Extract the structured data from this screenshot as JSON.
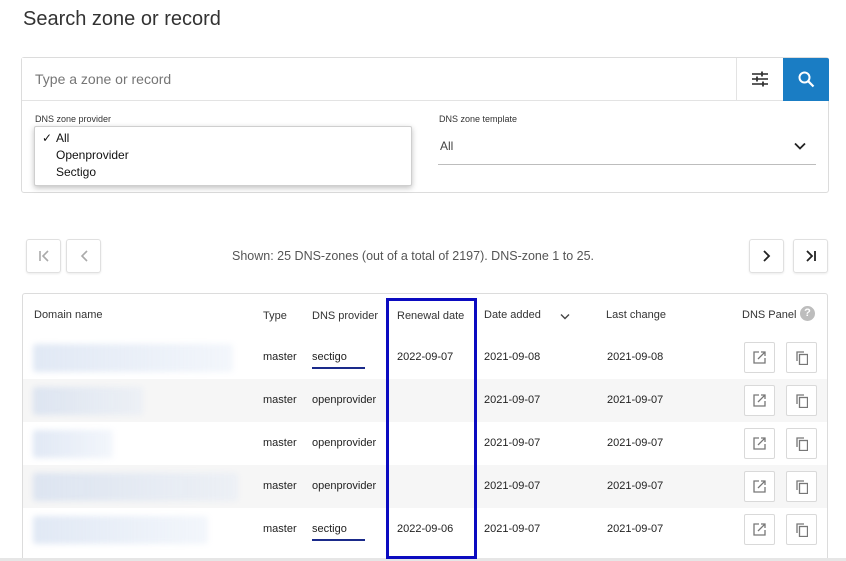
{
  "page_title": "Search zone or record",
  "search": {
    "placeholder": "Type a zone or record",
    "value": ""
  },
  "filters": {
    "provider_label": "DNS zone provider",
    "provider_options": [
      {
        "label": "All",
        "checked": true
      },
      {
        "label": "Openprovider",
        "checked": false
      },
      {
        "label": "Sectigo",
        "checked": false
      }
    ],
    "template_label": "DNS zone template",
    "template_value": "All"
  },
  "pagination": {
    "status": "Shown: 25 DNS-zones (out of a total of 2197). DNS-zone 1 to 25."
  },
  "table": {
    "headers": {
      "domain": "Domain name",
      "type": "Type",
      "provider": "DNS provider",
      "renewal": "Renewal date",
      "added": "Date added",
      "changed": "Last change",
      "panel": "DNS Panel"
    },
    "rows": [
      {
        "type": "master",
        "provider": "sectigo",
        "renewal": "2022-09-07",
        "added": "2021-09-08",
        "changed": "2021-09-08"
      },
      {
        "type": "master",
        "provider": "openprovider",
        "renewal": "",
        "added": "2021-09-07",
        "changed": "2021-09-07"
      },
      {
        "type": "master",
        "provider": "openprovider",
        "renewal": "",
        "added": "2021-09-07",
        "changed": "2021-09-07"
      },
      {
        "type": "master",
        "provider": "openprovider",
        "renewal": "",
        "added": "2021-09-07",
        "changed": "2021-09-07"
      },
      {
        "type": "master",
        "provider": "sectigo",
        "renewal": "2022-09-06",
        "added": "2021-09-07",
        "changed": "2021-09-07"
      }
    ]
  },
  "colors": {
    "accent": "#1a7dc4",
    "highlight": "#0b0bc0",
    "underline": "#1a2a8a"
  },
  "icons": {
    "filter": "sliders-icon",
    "search": "search-icon",
    "first_page": "first-page-icon",
    "prev_page": "chevron-left-icon",
    "next_page": "chevron-right-icon",
    "last_page": "last-page-icon",
    "sort": "chevron-down-icon",
    "help": "help-icon",
    "open": "open-external-icon",
    "copy": "copy-icon"
  }
}
